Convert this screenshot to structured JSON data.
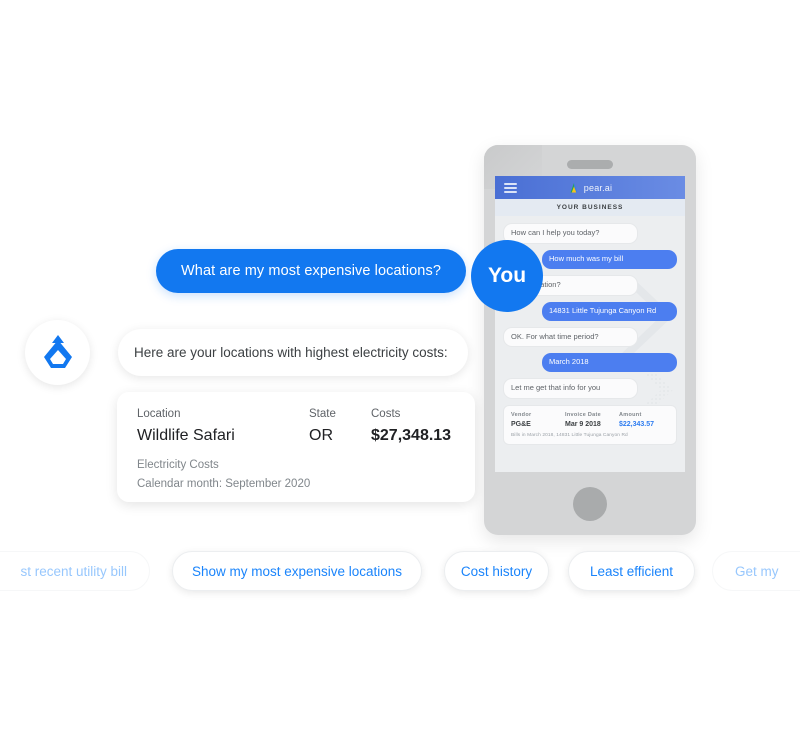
{
  "colors": {
    "accent_blue": "#1278f0",
    "chip_text_blue": "#1a84fb",
    "app_bar_blue": "#5b7fdd",
    "amount_blue": "#2d7cf0",
    "phone_frame": "#d4d5d6",
    "chat_bg": "#eceef0"
  },
  "conversation": {
    "user_question": "What are my most expensive locations?",
    "you_badge_label": "You",
    "bot_reply": "Here are your locations with highest electricity costs:"
  },
  "result_card": {
    "headers": {
      "location": "Location",
      "state": "State",
      "costs": "Costs"
    },
    "values": {
      "location": "Wildlife Safari",
      "state": "OR",
      "costs": "$27,348.13"
    },
    "subtitle": "Electricity Costs",
    "period": "Calendar month: September 2020"
  },
  "suggestion_chips": [
    {
      "label": "st recent utility bill",
      "faded": true
    },
    {
      "label": "Show my most expensive locations",
      "faded": false
    },
    {
      "label": "Cost history",
      "faded": false
    },
    {
      "label": "Least efficient",
      "faded": false
    },
    {
      "label": "Get my",
      "faded": true
    }
  ],
  "phone": {
    "app_bar": {
      "brand": "pear.ai",
      "menu_icon": "hamburger-menu-icon",
      "logo_icon": "pear-ai-triangle-logo"
    },
    "business_bar": "YOUR BUSINESS",
    "messages": [
      {
        "from": "bot",
        "text": "How can I help you today?"
      },
      {
        "from": "user",
        "text": "How much was my bill"
      },
      {
        "from": "bot",
        "text": "What location?"
      },
      {
        "from": "user",
        "text": "14831 Little Tujunga Canyon Rd"
      },
      {
        "from": "bot",
        "text": "OK. For what time period?"
      },
      {
        "from": "user",
        "text": "March 2018"
      },
      {
        "from": "bot",
        "text": "Let me get that info for you"
      }
    ],
    "invoice_card": {
      "headers": {
        "vendor": "Vendor",
        "invoice_date": "Invoice Date",
        "amount": "Amount"
      },
      "values": {
        "vendor": "PG&E",
        "invoice_date": "Mar 9 2018",
        "amount": "$22,343.57"
      },
      "footnote": "Bills in March 2018, 14831 Little Tujunga Canyon Rd"
    }
  },
  "bot_avatar_icon": "water-drop-logo-icon"
}
